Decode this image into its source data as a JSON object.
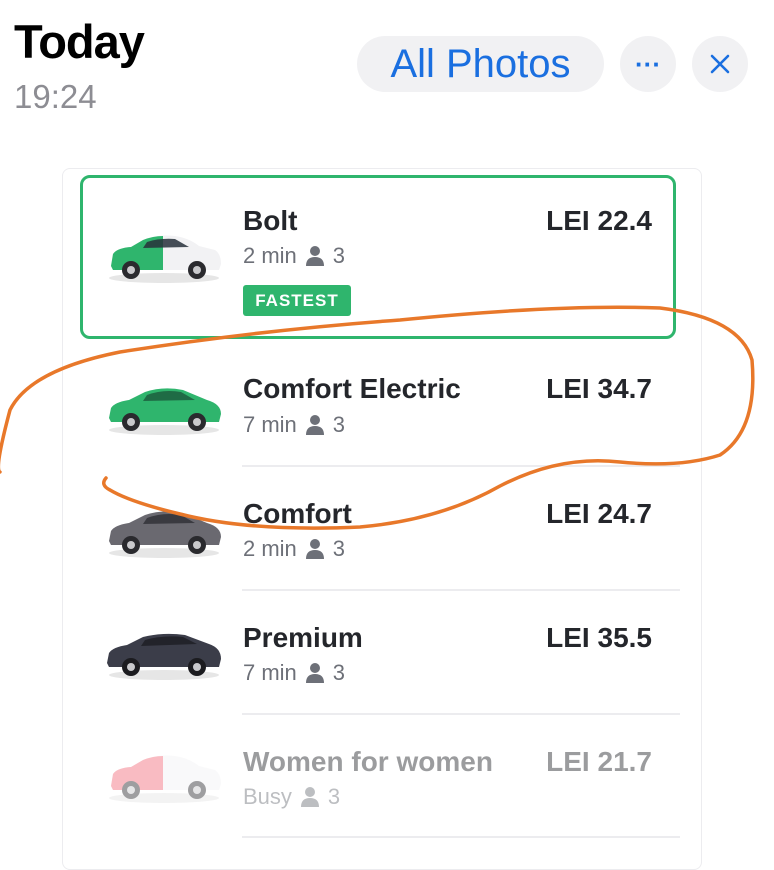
{
  "header": {
    "title": "Today",
    "time": "19:24",
    "all_photos_label": "All Photos",
    "more_label": "···"
  },
  "rides": [
    {
      "name": "Bolt",
      "eta": "2 min",
      "seats": "3",
      "price": "LEI 22.4",
      "badge": "FASTEST",
      "car_color": "two-tone-green-white",
      "selected": true
    },
    {
      "name": "Comfort Electric",
      "eta": "7 min",
      "seats": "3",
      "price": "LEI 34.7",
      "car_color": "#2fb56d"
    },
    {
      "name": "Comfort",
      "eta": "2 min",
      "seats": "3",
      "price": "LEI 24.7",
      "car_color": "#6a6970"
    },
    {
      "name": "Premium",
      "eta": "7 min",
      "seats": "3",
      "price": "LEI 35.5",
      "car_color": "#3b3d49"
    },
    {
      "name": "Women for women",
      "eta": "Busy",
      "seats": "3",
      "price": "LEI 21.7",
      "car_color": "two-tone-pink-white",
      "disabled": true
    }
  ],
  "colors": {
    "accent_blue": "#1a6fe0",
    "bolt_green": "#2fb56d",
    "annotation_orange": "#e8782a"
  }
}
